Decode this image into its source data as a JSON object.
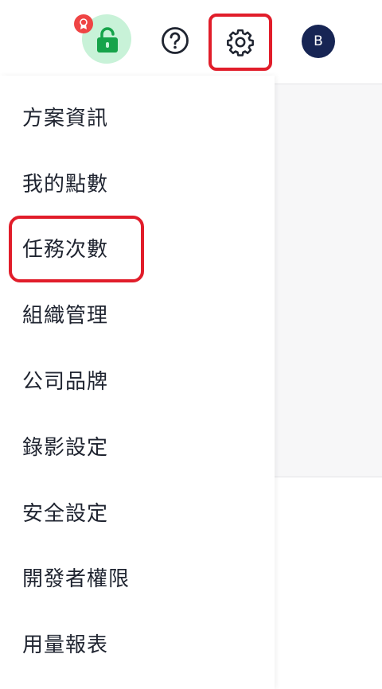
{
  "header": {
    "avatar_initial": "B",
    "upgrade_icon": "lock-open-icon",
    "notify_icon": "medal-icon",
    "help_icon": "question-circle-icon",
    "settings_icon": "gear-icon"
  },
  "settings_menu": {
    "items": [
      {
        "label": "方案資訊"
      },
      {
        "label": "我的點數"
      },
      {
        "label": "任務次數"
      },
      {
        "label": "組織管理"
      },
      {
        "label": "公司品牌"
      },
      {
        "label": "錄影設定"
      },
      {
        "label": "安全設定"
      },
      {
        "label": "開發者權限"
      },
      {
        "label": "用量報表"
      }
    ]
  },
  "colors": {
    "accent_red": "#e11d2a",
    "avatar_bg": "#172554",
    "upgrade_bg": "#c8f2d8",
    "lock_green": "#16a34a"
  }
}
